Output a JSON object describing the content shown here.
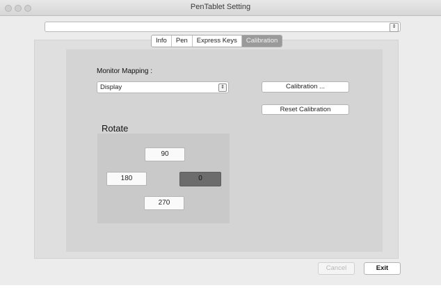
{
  "window": {
    "title": "PenTablet Setting"
  },
  "device_select": {
    "value": ""
  },
  "tabs": [
    {
      "label": "Info",
      "active": false
    },
    {
      "label": "Pen",
      "active": false
    },
    {
      "label": "Express Keys",
      "active": false
    },
    {
      "label": "Calibration",
      "active": true
    }
  ],
  "calibration": {
    "monitor_mapping_label": "Monitor Mapping :",
    "monitor_select_value": "Display",
    "calibration_button": "Calibration ...",
    "reset_button": "Reset Calibration",
    "rotate_label": "Rotate",
    "rotate_options": {
      "r90": "90",
      "r180": "180",
      "r0": "0",
      "r270": "270"
    },
    "rotate_selected": "0"
  },
  "footer": {
    "cancel_label": "Cancel",
    "exit_label": "Exit"
  },
  "colors": {
    "selected_rotate": "#6c6c6c",
    "active_tab": "#9a9a9a"
  }
}
